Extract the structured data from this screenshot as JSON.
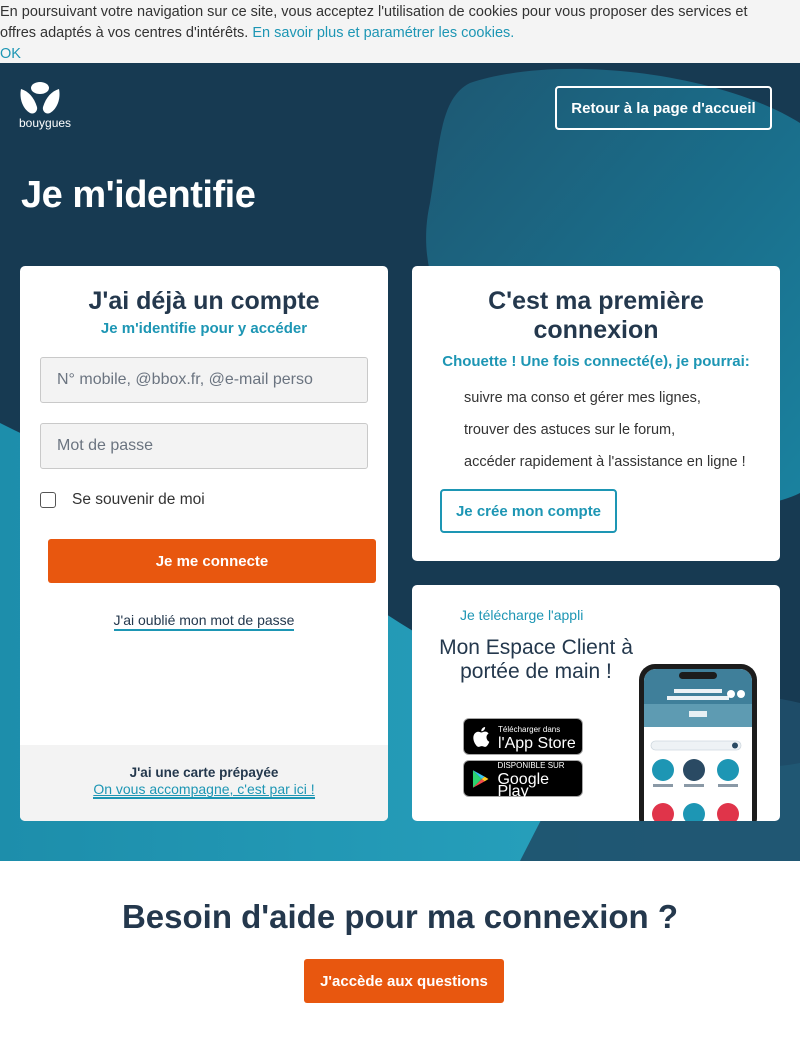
{
  "cookie": {
    "text": "En poursuivant votre navigation sur ce site, vous acceptez l'utilisation de cookies pour vous proposer des services et offres adaptés à vos centres d'intérêts.",
    "link": "En savoir plus et paramétrer les cookies.",
    "ok": "OK"
  },
  "header": {
    "logo_text": "bouygues",
    "home_button": "Retour à la page d'accueil"
  },
  "page_title": "Je m'identifie",
  "login": {
    "title": "J'ai déjà un compte",
    "subtitle": "Je m'identifie pour y accéder",
    "username_placeholder": "N° mobile, @bbox.fr, @e-mail perso",
    "password_placeholder": "Mot de passe",
    "remember_label": "Se souvenir de moi",
    "remember_checked": false,
    "submit": "Je me connecte",
    "forgot": "J'ai oublié mon mot de passe",
    "prepaid_title": "J'ai une carte prépayée",
    "prepaid_link": "On vous accompagne, c'est par ici !"
  },
  "first": {
    "title": "C'est ma première connexion",
    "subtitle": "Chouette ! Une fois connecté(e), je pourrai:",
    "bullets": [
      "suivre ma conso et gérer mes lignes,",
      "trouver des astuces sur le forum,",
      "accéder rapidement à l'assistance en ligne !"
    ],
    "cta": "Je crée mon compte"
  },
  "app": {
    "kicker": "Je télécharge l'appli",
    "title": "Mon Espace Client à portée de main !",
    "appstore_small": "Télécharger dans",
    "appstore_big": "l'App Store",
    "gplay_small": "DISPONIBLE SUR",
    "gplay_big": "Google Play"
  },
  "help": {
    "title": "Besoin d'aide pour ma connexion ?",
    "cta": "J'accède aux questions"
  },
  "colors": {
    "navy": "#173a52",
    "teal": "#1d96b4",
    "orange": "#e8570f",
    "text": "#24384d"
  }
}
